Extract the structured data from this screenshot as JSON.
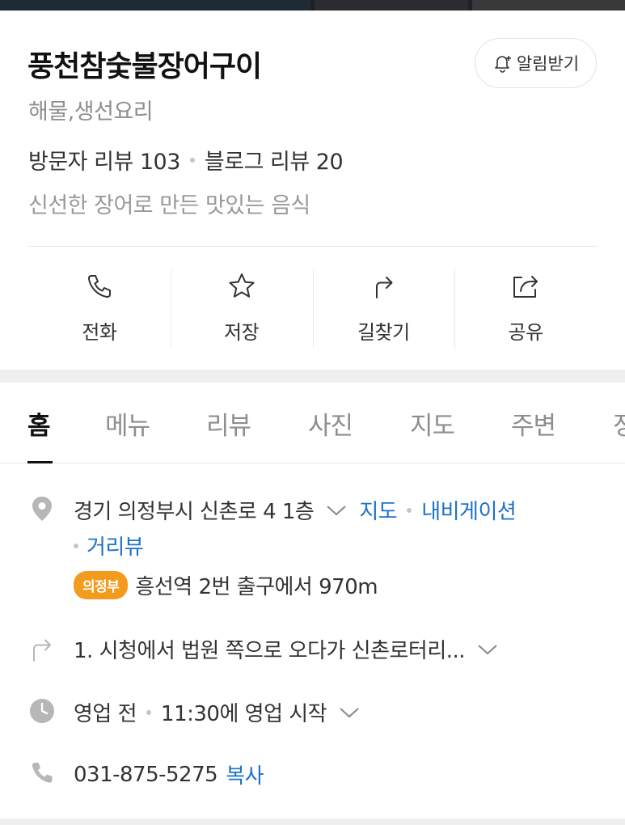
{
  "place": {
    "name": "풍천참숯불장어구이",
    "category": "해물,생선요리",
    "visitor_reviews": "방문자 리뷰 103",
    "blog_reviews": "블로그 리뷰 20",
    "tagline": "신선한 장어로 만든 맛있는 음식",
    "notify_label": "알림받기"
  },
  "actions": [
    {
      "label": "전화",
      "icon": "phone-icon"
    },
    {
      "label": "저장",
      "icon": "star-icon"
    },
    {
      "label": "길찾기",
      "icon": "directions-icon"
    },
    {
      "label": "공유",
      "icon": "share-icon"
    }
  ],
  "tabs": [
    "홈",
    "메뉴",
    "리뷰",
    "사진",
    "지도",
    "주변",
    "정"
  ],
  "active_tab": "홈",
  "info": {
    "address": "경기 의정부시 신촌로 4 1층",
    "map_link": "지도",
    "navi_link": "내비게이션",
    "streetview_link": "거리뷰",
    "subway_line": "의정부",
    "subway_text": "흥선역 2번 출구에서 970m",
    "directions": "1. 시청에서 법원 쪽으로 오다가 신촌로터리...",
    "status": "영업 전",
    "hours": "11:30에 영업 시작",
    "phone": "031-875-5275",
    "copy_label": "복사"
  },
  "colors": {
    "link": "#1d72c9",
    "badge": "#f29b1c"
  }
}
